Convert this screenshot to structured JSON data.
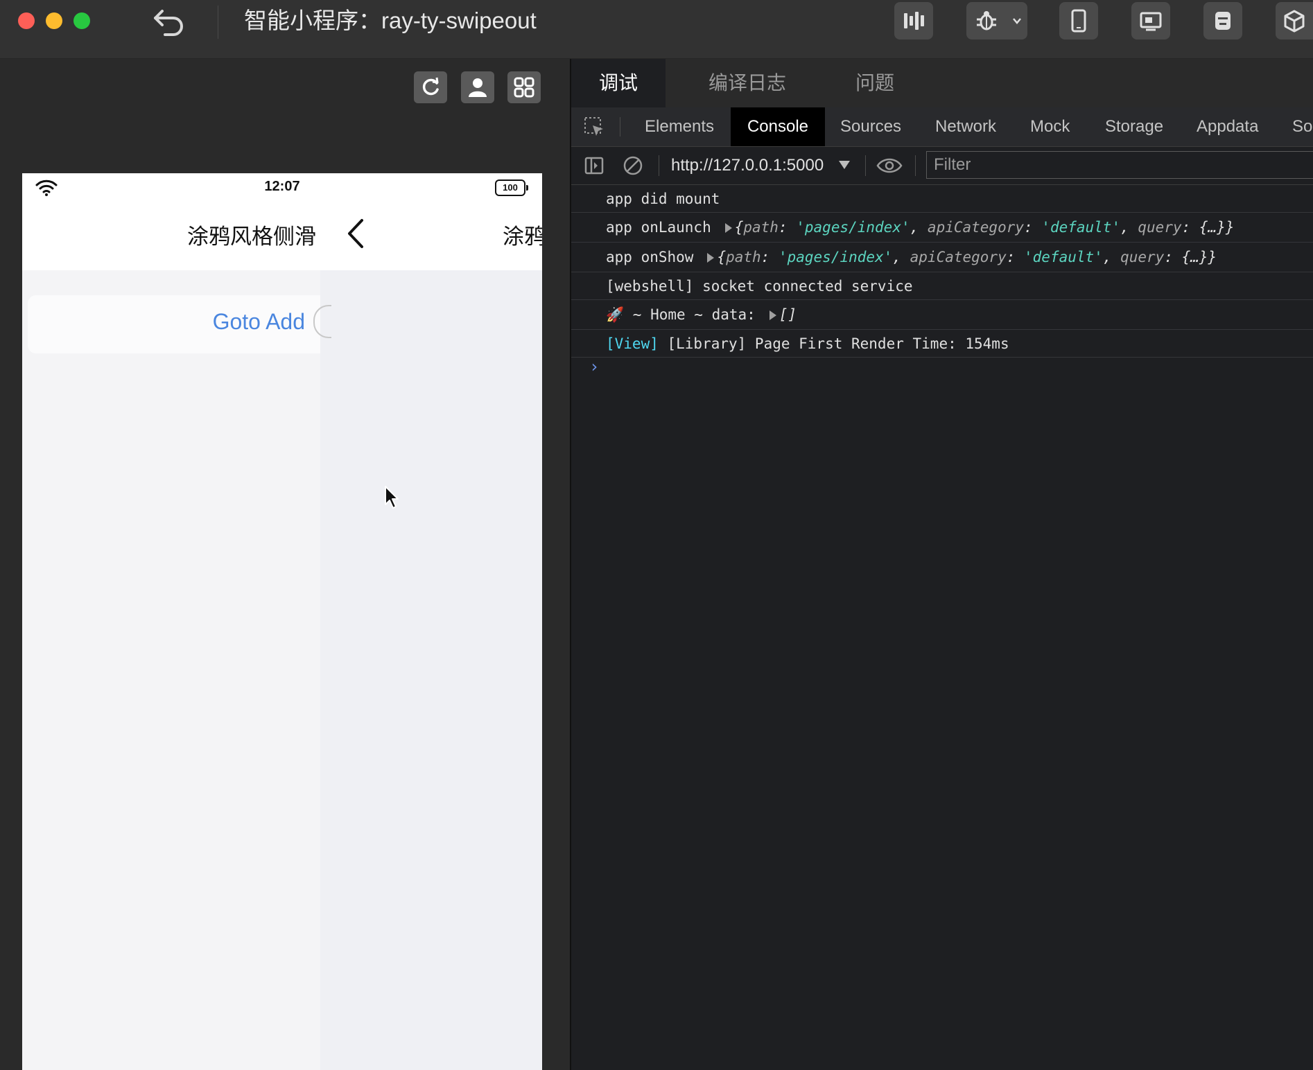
{
  "window": {
    "title": "智能小程序：ray-ty-swipeout"
  },
  "simulator": {
    "status_time": "12:07",
    "battery": "100",
    "nav_title_current": "涂鸦风格侧滑",
    "nav_title_next": "涂鸦",
    "swipe_action_label": "Goto Add"
  },
  "devtools": {
    "top_tabs": [
      "调试",
      "编译日志",
      "问题"
    ],
    "panel_tabs": [
      "Elements",
      "Console",
      "Sources",
      "Network",
      "Mock",
      "Storage",
      "Appdata",
      "So"
    ],
    "active_panel": "Console",
    "context": "http://127.0.0.1:5000",
    "filter_placeholder": "Filter",
    "logs": {
      "line1": "app did mount",
      "line2_prefix": "app onLaunch",
      "line3_prefix": "app onShow",
      "obj_open": "{",
      "key_path": "path",
      "colon": ": ",
      "val_path": "'pages/index'",
      "comma": ", ",
      "key_api": "apiCategory",
      "val_api": "'default'",
      "key_query": "query",
      "val_query": "{…}}",
      "line4": "[webshell] socket connected service",
      "line5_prefix": "🚀 ~ Home ~ data:",
      "line5_value": "[]",
      "line6_tag": "[View]",
      "line6_text": " [Library] Page First Render Time: 154ms"
    },
    "prompt": "›"
  },
  "colors": {
    "accent_blue": "#4a86df",
    "console_string": "#5cd5c0",
    "view_tag": "#4fd7f0"
  }
}
